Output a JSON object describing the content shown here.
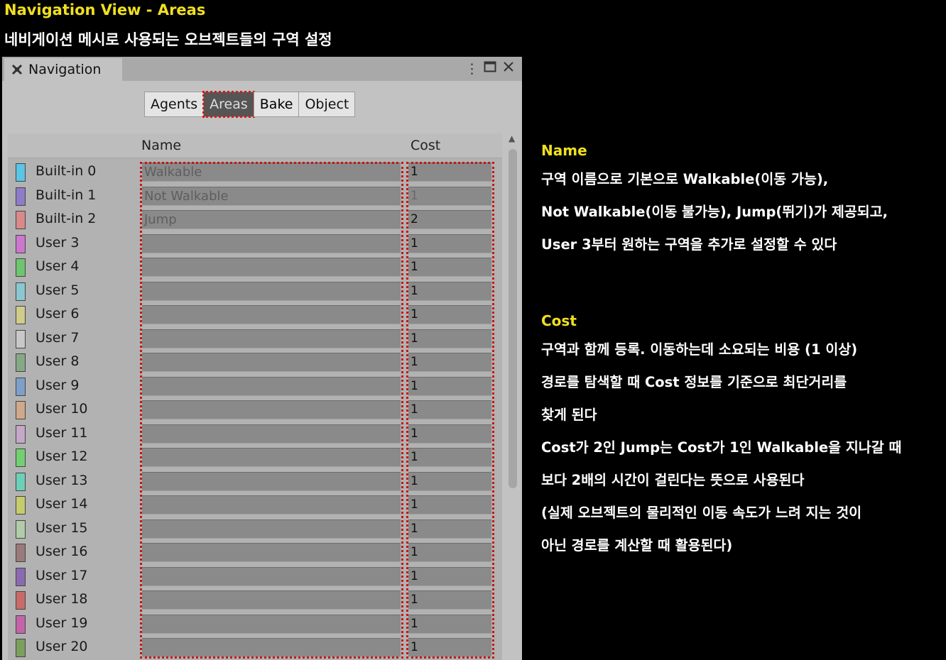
{
  "header": {
    "title": "Navigation View - Areas",
    "subtitle": "네비게이션 메시로 사용되는 오브젝트들의 구역 설정"
  },
  "window": {
    "tab_title": "Navigation",
    "icons": [
      "navigation-icon",
      "more-options-icon",
      "maximize-icon",
      "close-icon"
    ]
  },
  "toolbar": {
    "buttons": [
      "Agents",
      "Areas",
      "Bake",
      "Object"
    ],
    "active": "Areas"
  },
  "table": {
    "headers": {
      "name": "Name",
      "cost": "Cost"
    },
    "rows": [
      {
        "label": "Built-in 0",
        "name": "Walkable",
        "cost": "1",
        "color": "#5cc4e4"
      },
      {
        "label": "Built-in 1",
        "name": "Not Walkable",
        "cost": "1",
        "color": "#8e7cc8"
      },
      {
        "label": "Built-in 2",
        "name": "Jump",
        "cost": "2",
        "color": "#d88a8a"
      },
      {
        "label": "User 3",
        "name": "",
        "cost": "1",
        "color": "#cc77cc"
      },
      {
        "label": "User 4",
        "name": "",
        "cost": "1",
        "color": "#6fc46f"
      },
      {
        "label": "User 5",
        "name": "",
        "cost": "1",
        "color": "#8ac8cf"
      },
      {
        "label": "User 6",
        "name": "",
        "cost": "1",
        "color": "#d0cc8a"
      },
      {
        "label": "User 7",
        "name": "",
        "cost": "1",
        "color": "#c8c8c8"
      },
      {
        "label": "User 8",
        "name": "",
        "cost": "1",
        "color": "#86a886"
      },
      {
        "label": "User 9",
        "name": "",
        "cost": "1",
        "color": "#7ea0c8"
      },
      {
        "label": "User 10",
        "name": "",
        "cost": "1",
        "color": "#cfa98a"
      },
      {
        "label": "User 11",
        "name": "",
        "cost": "1",
        "color": "#c4a8c8"
      },
      {
        "label": "User 12",
        "name": "",
        "cost": "1",
        "color": "#72d072"
      },
      {
        "label": "User 13",
        "name": "",
        "cost": "1",
        "color": "#6cd0b8"
      },
      {
        "label": "User 14",
        "name": "",
        "cost": "1",
        "color": "#c4cc6c"
      },
      {
        "label": "User 15",
        "name": "",
        "cost": "1",
        "color": "#b0cca8"
      },
      {
        "label": "User 16",
        "name": "",
        "cost": "1",
        "color": "#9a7a7a"
      },
      {
        "label": "User 17",
        "name": "",
        "cost": "1",
        "color": "#8a6ab0"
      },
      {
        "label": "User 18",
        "name": "",
        "cost": "1",
        "color": "#c86a6a"
      },
      {
        "label": "User 19",
        "name": "",
        "cost": "1",
        "color": "#c464a8"
      },
      {
        "label": "User 20",
        "name": "",
        "cost": "1",
        "color": "#7c9e5e"
      }
    ]
  },
  "notes": {
    "name_heading": "Name",
    "name_lines": [
      "구역 이름으로 기본으로 Walkable(이동 가능),",
      "Not Walkable(이동 불가능), Jump(뛰기)가 제공되고,",
      "User 3부터 원하는 구역을 추가로 설정할 수 있다"
    ],
    "cost_heading": "Cost",
    "cost_lines": [
      "구역과 함께 등록. 이동하는데 소요되는 비용 (1 이상)",
      "경로를 탐색할 때 Cost 정보를 기준으로 최단거리를",
      "찾게 된다",
      "Cost가 2인 Jump는 Cost가 1인 Walkable을 지나갈 때",
      "보다 2배의 시간이 걸린다는 뜻으로 사용된다",
      "(실제 오브젝트의 물리적인 이동 속도가 느려 지는 것이",
      "아닌 경로를 계산할 때 활용된다)"
    ]
  },
  "colors": {
    "heading_yellow": "#f0e020",
    "highlight_red": "#c81414"
  }
}
